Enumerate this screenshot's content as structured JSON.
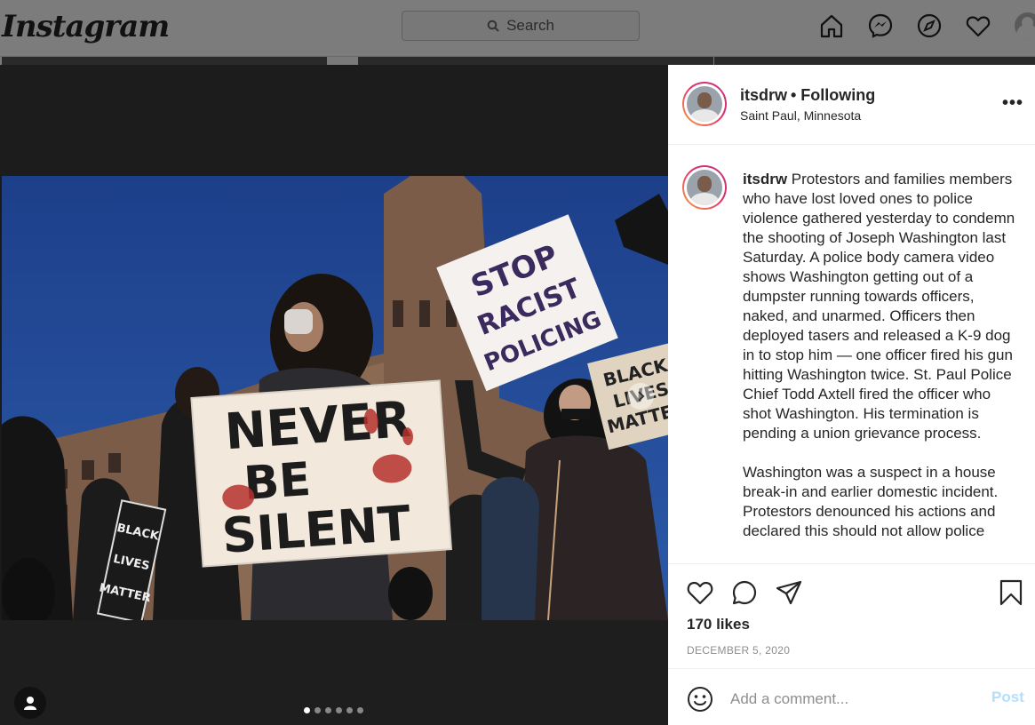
{
  "app": {
    "logo": "Instagram",
    "search_placeholder": "Search"
  },
  "icons": {
    "home": "home-icon",
    "messenger": "messenger-icon",
    "explore": "compass-icon",
    "activity": "heart-icon",
    "profile": "avatar"
  },
  "post": {
    "username": "itsdrw",
    "follow_status": "• Following",
    "location": "Saint Paul, Minnesota",
    "more": "•••",
    "caption_user": "itsdrw",
    "caption_text": "Protestors and families members who have lost loved ones to police violence gathered yesterday to condemn the shooting of Joseph Washington last Saturday. A police body camera video shows Washington getting out of a dumpster running towards officers, naked, and unarmed. Officers then deployed tasers and released a K-9 dog in to stop him — one officer fired his gun hitting Washington twice. St. Paul Police Chief Todd Axtell fired the officer who shot Washington. His termination is pending a union grievance process.\n\nWashington was a suspect in a house break-in and earlier domestic incident. Protestors denounced his actions and declared this should not allow police",
    "likes": "170 likes",
    "date": "DECEMBER 5, 2020",
    "comment_placeholder": "Add a comment...",
    "post_label": "Post",
    "carousel_count": 6,
    "carousel_active": 1
  },
  "photo": {
    "sign_left": "NEVER BE SILENT",
    "sign_left_lines": [
      "NEVER",
      "BE",
      "SILENT"
    ],
    "sign_right_lines": [
      "STOP",
      "RACIST",
      "POLICING"
    ],
    "sign_far_lines": [
      "BLACK",
      "LIVES",
      "MATTER"
    ],
    "sign_small_lines": [
      "BLACK",
      "LIVES",
      "MATTER"
    ]
  },
  "colors": {
    "like_accent": "#262626",
    "post_disabled": "#b2dffc",
    "story_ring_start": "#f9a43f",
    "story_ring_end": "#c13584"
  }
}
